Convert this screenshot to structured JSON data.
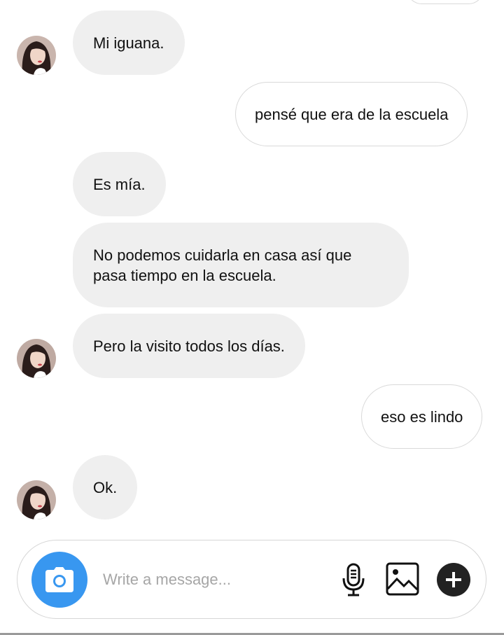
{
  "conversation": {
    "messages": [
      {
        "sender": "them",
        "text": "Mi iguana.",
        "avatar": true
      },
      {
        "sender": "me",
        "text": "pensé que era de la escuela"
      },
      {
        "sender": "them",
        "text": "Es mía."
      },
      {
        "sender": "them",
        "text": "No podemos cuidarla en casa así que pasa tiempo en la escuela."
      },
      {
        "sender": "them",
        "text": "Pero la visito todos los días.",
        "avatar": true
      },
      {
        "sender": "me",
        "text": "eso es lindo"
      },
      {
        "sender": "them",
        "text": "Ok.",
        "avatar": true
      }
    ]
  },
  "composer": {
    "placeholder": "Write a message...",
    "value": "",
    "icons": [
      "camera-icon",
      "microphone-icon",
      "gallery-icon",
      "plus-icon"
    ]
  },
  "colors": {
    "accent": "#3897f0",
    "incoming_bubble": "#efefef",
    "outgoing_border": "#d9d9d9",
    "plus_button": "#222222"
  }
}
